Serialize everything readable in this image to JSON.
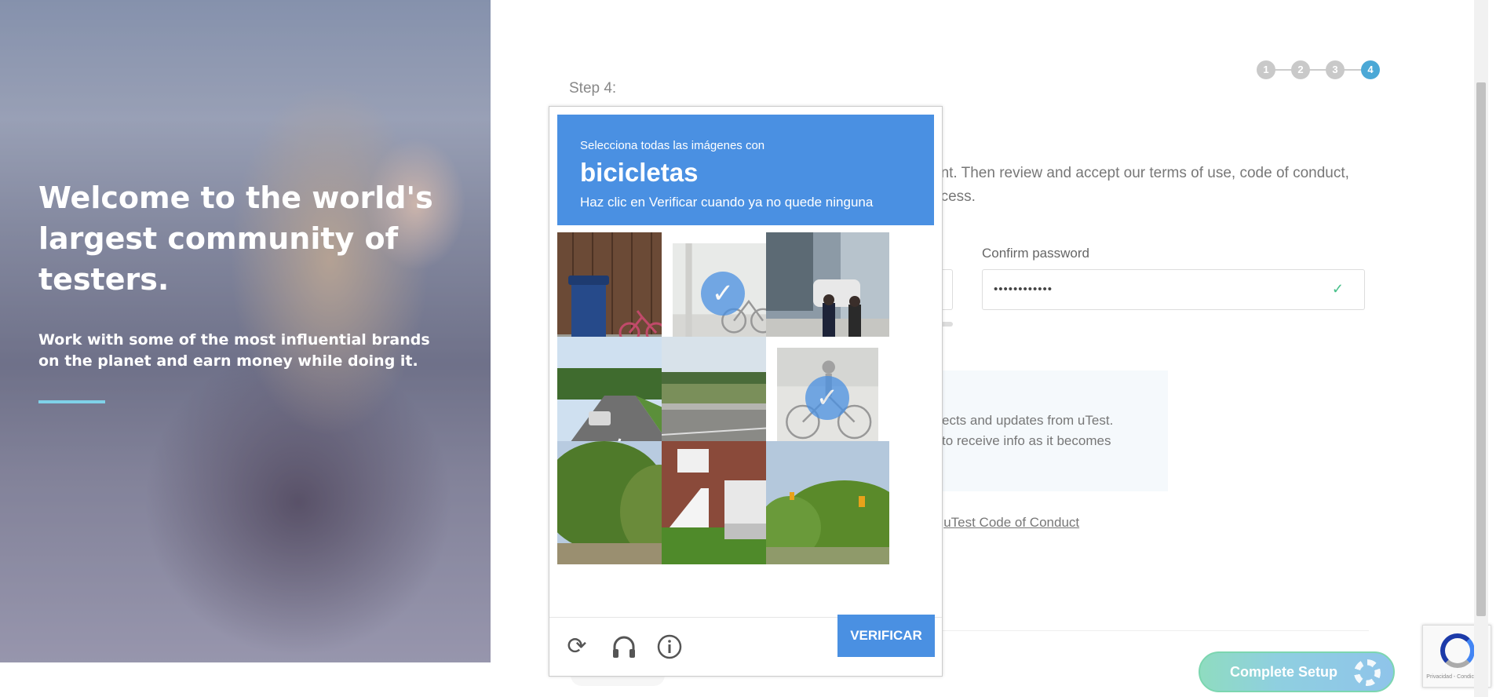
{
  "hero": {
    "title": "Welcome to the world's largest community of testers.",
    "subtitle": "Work with some of the most influential brands on the planet and earn money while doing it."
  },
  "steps": {
    "items": [
      "1",
      "2",
      "3",
      "4"
    ],
    "active": 4,
    "label": "Step 4:"
  },
  "form": {
    "description_line1": "unt. Then review and accept our terms of use, code of conduct,",
    "description_line2": "ocess.",
    "confirm_password_label": "Confirm password",
    "confirm_password_value": "••••••••••••",
    "info_line1": "ects and updates from uTest.",
    "info_line2": "to receive info as it becomes",
    "coc_prefix": "e ",
    "coc_link": "uTest Code of Conduct",
    "complete_button": "Complete Setup"
  },
  "captcha": {
    "prompt_small": "Selecciona todas las imágenes con",
    "prompt_object": "bicicletas",
    "prompt_instruction": "Haz clic en Verificar cuando ya no quede ninguna",
    "tiles": [
      {
        "scene": "trash bin and bicycle by wooden fence",
        "selected": false
      },
      {
        "scene": "bicycle on sidewalk",
        "selected": true
      },
      {
        "scene": "pedestrians at crosswalk",
        "selected": false
      },
      {
        "scene": "road with car",
        "selected": false
      },
      {
        "scene": "highway with guardrail",
        "selected": false
      },
      {
        "scene": "cyclist riding",
        "selected": true
      },
      {
        "scene": "trees along road",
        "selected": false
      },
      {
        "scene": "house with garage",
        "selected": false
      },
      {
        "scene": "traffic light and trees",
        "selected": false
      }
    ],
    "reload_icon": "reload-icon",
    "audio_icon": "headphones-icon",
    "info_icon": "info-icon",
    "verify_label": "VERIFICAR",
    "accent": "#4a90e2"
  },
  "recaptcha_badge": {
    "terms": "Privacidad - Condiciones"
  }
}
